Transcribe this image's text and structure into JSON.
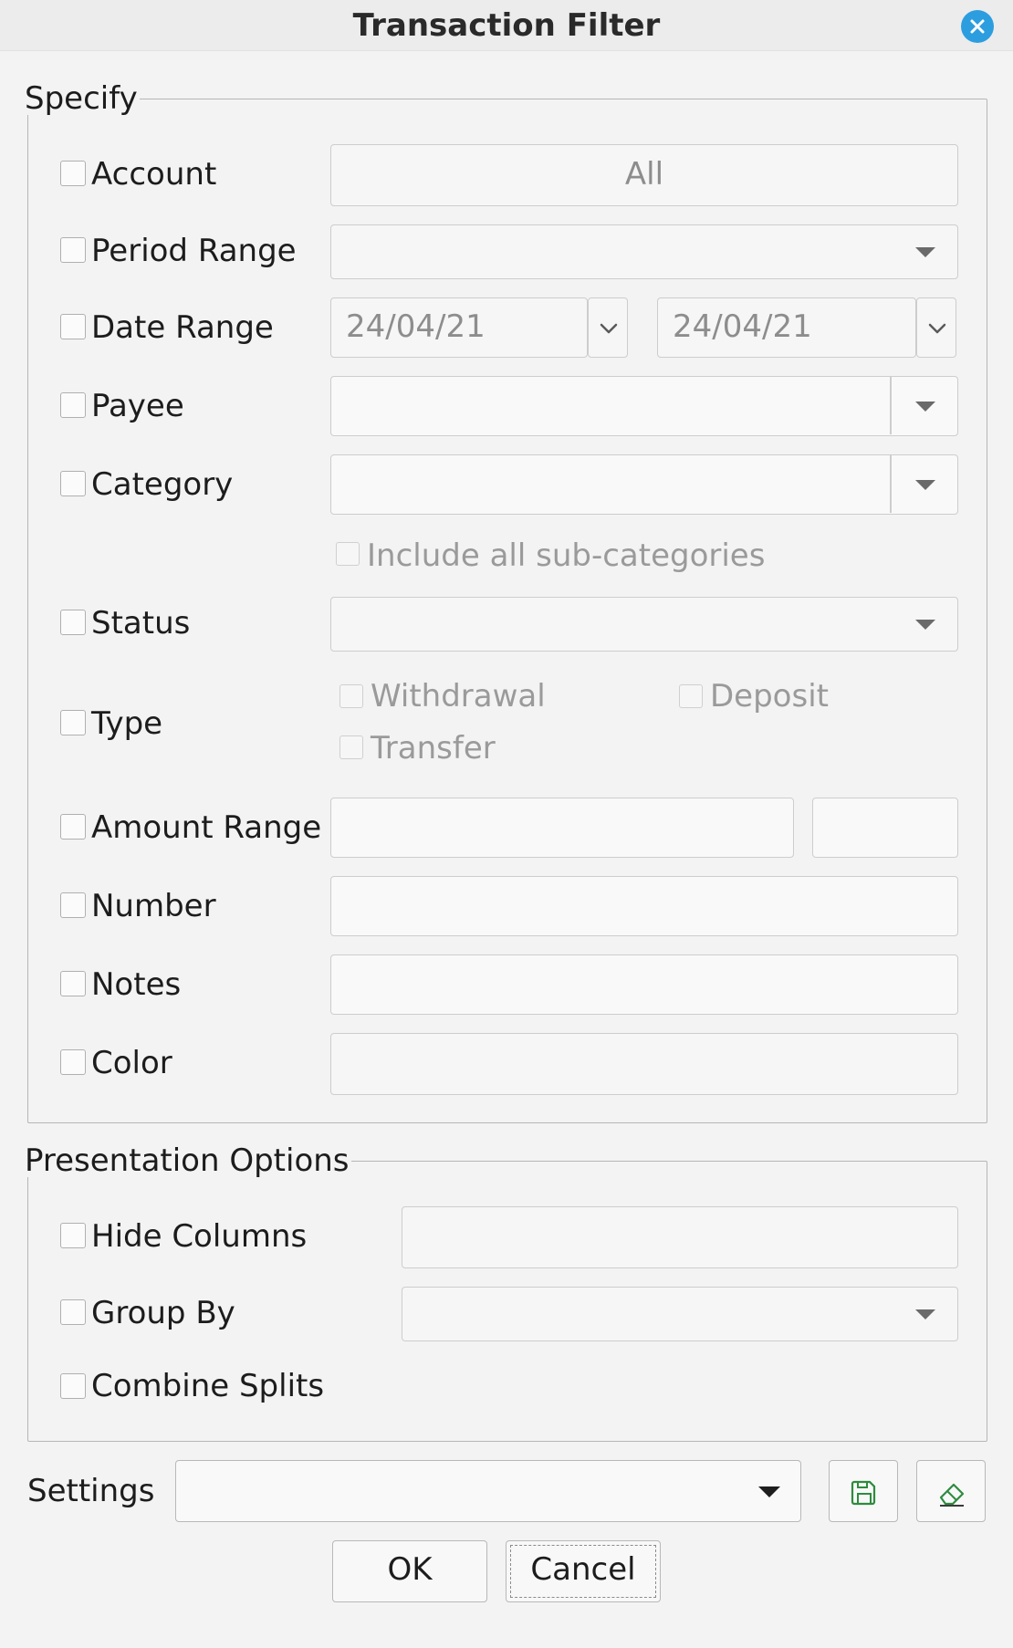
{
  "window": {
    "title": "Transaction Filter",
    "close_icon": "close-icon"
  },
  "specify": {
    "legend": "Specify",
    "account": {
      "label": "Account",
      "value": "All",
      "checked": false
    },
    "period_range": {
      "label": "Period Range",
      "value": "",
      "checked": false
    },
    "date_range": {
      "label": "Date Range",
      "from": "24/04/21",
      "to": "24/04/21",
      "checked": false
    },
    "payee": {
      "label": "Payee",
      "value": "",
      "checked": false
    },
    "category": {
      "label": "Category",
      "value": "",
      "checked": false,
      "include_sub_label": "Include all sub-categories"
    },
    "status": {
      "label": "Status",
      "value": "",
      "checked": false
    },
    "type": {
      "label": "Type",
      "checked": false,
      "options": {
        "withdrawal": "Withdrawal",
        "deposit": "Deposit",
        "transfer": "Transfer"
      }
    },
    "amount_range": {
      "label": "Amount Range",
      "min": "",
      "max": "",
      "checked": false
    },
    "number": {
      "label": "Number",
      "value": "",
      "checked": false
    },
    "notes": {
      "label": "Notes",
      "value": "",
      "checked": false
    },
    "color": {
      "label": "Color",
      "value": "",
      "checked": false
    }
  },
  "presentation": {
    "legend": "Presentation Options",
    "hide_columns": {
      "label": "Hide Columns",
      "value": "",
      "checked": false
    },
    "group_by": {
      "label": "Group By",
      "value": "",
      "checked": false
    },
    "combine_splits": {
      "label": "Combine Splits",
      "checked": false
    }
  },
  "settings": {
    "label": "Settings",
    "value": "",
    "save_icon": "save-icon",
    "clear_icon": "eraser-icon"
  },
  "buttons": {
    "ok": "OK",
    "cancel": "Cancel"
  },
  "colors": {
    "close_button": "#2c9ee0",
    "save_icon": "#2e8b3e",
    "background": "#f3f3f3"
  }
}
